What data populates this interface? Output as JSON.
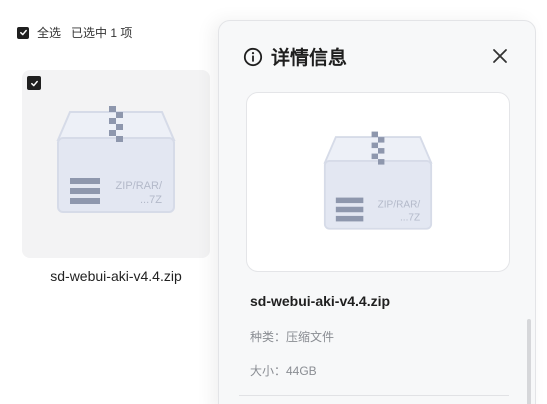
{
  "selection_bar": {
    "select_all_label": "全选",
    "selected_count_label": "已选中 1 项"
  },
  "file": {
    "name": "sd-webui-aki-v4.4.zip",
    "thumb_label_line1": "ZIP/RAR/",
    "thumb_label_line2": "...7Z",
    "icon": "zip-archive-icon"
  },
  "details_panel": {
    "title": "详情信息",
    "title_icon": "info-icon",
    "close_icon": "close-icon",
    "file_name": "sd-webui-aki-v4.4.zip",
    "type_text": "种类：压缩文件",
    "size_text": "大小：44GB"
  },
  "colors": {
    "checkbox_fill": "#1f1f1f",
    "card_bg": "#f3f3f4",
    "panel_bg": "#f7f8f9",
    "zip_box_face": "#e6e9f3",
    "zip_box_stripe": "#9aa3b8"
  }
}
